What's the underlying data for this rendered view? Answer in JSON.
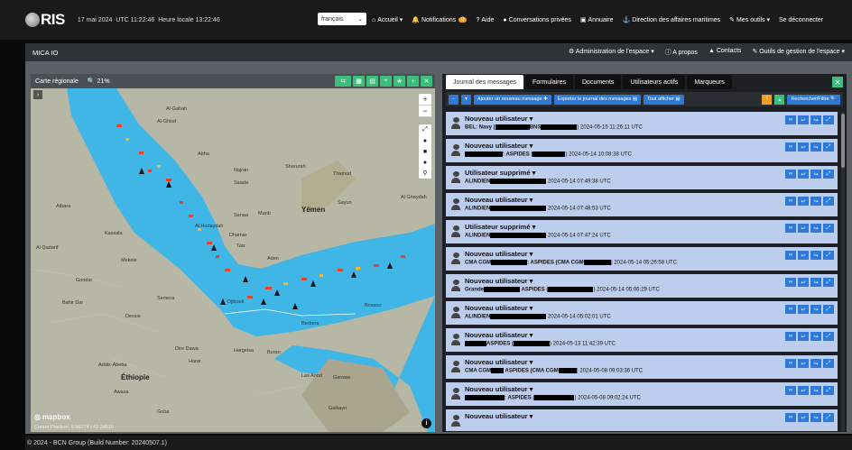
{
  "topbar": {
    "logo": "RIS",
    "date": "17 mai 2024",
    "utc": "UTC  11:22:46",
    "local": "Heure locale 13:22:46",
    "language": "français",
    "nav": [
      {
        "icon": "home-icon",
        "label": "Accueil ▾"
      },
      {
        "icon": "bell-icon",
        "label": "Notifications",
        "badge": "0"
      },
      {
        "icon": "question-icon",
        "label": "Aide"
      },
      {
        "icon": "chat-icon",
        "label": "Conversations privées"
      },
      {
        "icon": "book-icon",
        "label": "Annuaire"
      },
      {
        "icon": "anchor-icon",
        "label": "Direction des affaires maritimes"
      },
      {
        "icon": "wrench-icon",
        "label": "Mes outils ▾"
      },
      {
        "icon": "logout-icon",
        "label": "Se déconnecter"
      }
    ]
  },
  "subbar": {
    "title": "MICA IO",
    "nav": [
      {
        "label": "Administration de l'espace ▾"
      },
      {
        "label": "A propos"
      },
      {
        "label": "Contacts"
      },
      {
        "label": "Outils de gestion de l'espace ▾"
      }
    ]
  },
  "map": {
    "title": "Carte régionale",
    "zoom": "21%",
    "labels": [
      {
        "text": "Al-Gahah"
      },
      {
        "text": "Al-Ghisd"
      },
      {
        "text": "Abha"
      },
      {
        "text": "Najran"
      },
      {
        "text": "Sharurah"
      },
      {
        "text": "Thamud"
      },
      {
        "text": "Saada"
      },
      {
        "text": "Al Ghaydah"
      },
      {
        "text": "Yémen"
      },
      {
        "text": "Sayun"
      },
      {
        "text": "Sanaa"
      },
      {
        "text": "Marib"
      },
      {
        "text": "Dhamar"
      },
      {
        "text": "Al Hudaydah"
      },
      {
        "text": "Taiz"
      },
      {
        "text": "Aden"
      },
      {
        "text": "Atbara"
      },
      {
        "text": "Kassala"
      },
      {
        "text": "Al Qadarif"
      },
      {
        "text": "Mekele"
      },
      {
        "text": "Gondar"
      },
      {
        "text": "Bahir Dar"
      },
      {
        "text": "Dessie"
      },
      {
        "text": "Semera"
      },
      {
        "text": "Djibouti"
      },
      {
        "text": "Bosaso"
      },
      {
        "text": "Berbera"
      },
      {
        "text": "Hargeisa"
      },
      {
        "text": "Burao"
      },
      {
        "text": "Dire Dawa"
      },
      {
        "text": "Addis-Abeba"
      },
      {
        "text": "Éthiopie"
      },
      {
        "text": "Awasa"
      },
      {
        "text": "Las Anod"
      },
      {
        "text": "Garowe"
      },
      {
        "text": "Galkayo"
      },
      {
        "text": "Harar"
      },
      {
        "text": "Goba"
      }
    ],
    "mapbox": "mapbox",
    "cursor": "Cursor Position: 8.56774 / 42.24515"
  },
  "messages": {
    "tabs": [
      "Journal des messages",
      "Formulaires",
      "Documents",
      "Utilisateurs actifs",
      "Marqueurs"
    ],
    "toolbar": {
      "new_message": "Ajouter un nouveau message ✚",
      "export": "Exporter le journal des messages ▤",
      "show_all": "Tout afficher ▤",
      "search": "Rechercher/Filtre 🔍"
    },
    "rows": [
      {
        "title": "Nouveau utilisateur ▾",
        "pre": "BEL: Navy (",
        "mid": "BNS",
        "post": ") 2024-05-15 11:26:11 UTC",
        "r1": 38,
        "r2": 40
      },
      {
        "title": "Nouveau utilisateur ▾",
        "pre": "",
        "mid": ": ASPIDES (",
        "post": ") 2024-05-14 10:08:38 UTC",
        "r1": 42,
        "r2": 36
      },
      {
        "title": "Utilisateur supprimé ▾",
        "pre": "ALINDIEN",
        "mid": "",
        "post": " 2024-05-14 07:49:38 UTC",
        "r1": 62,
        "r2": 0
      },
      {
        "title": "Nouveau utilisateur ▾",
        "pre": "ALINDIEN",
        "mid": "",
        "post": " 2024-05-14 07:48:53 UTC",
        "r1": 62,
        "r2": 0
      },
      {
        "title": "Utilisateur supprimé ▾",
        "pre": "ALINDIEN",
        "mid": "",
        "post": " 2024-05-14 07:47:24 UTC",
        "r1": 62,
        "r2": 0
      },
      {
        "title": "Nouveau utilisateur ▾",
        "pre": "CMA CGM",
        "mid": ": ASPIDES (CMA CGM",
        "post": ") 2024-05-14 05:26:58 UTC",
        "r1": 40,
        "r2": 30
      },
      {
        "title": "Nouveau utilisateur ▾",
        "pre": "Grande",
        "mid": " ASPIDES (",
        "post": ") 2024-05-14 05:06:29 UTC",
        "r1": 40,
        "r2": 50
      },
      {
        "title": "Nouveau utilisateur ▾",
        "pre": "ALINDIEN",
        "mid": "",
        "post": " 2024-05-14 05:02:01 UTC",
        "r1": 62,
        "r2": 0
      },
      {
        "title": "Nouveau utilisateur ▾",
        "pre": "",
        "mid": "ASPIDES (",
        "post": ") 2024-05-13 11:42:39 UTC",
        "r1": 24,
        "r2": 40
      },
      {
        "title": "Nouveau utilisateur ▾",
        "pre": "CMA CGM",
        "mid": " ASPIDES (CMA CGM",
        "post": ") 2024-05-08 09:03:36 UTC",
        "r1": 14,
        "r2": 20
      },
      {
        "title": "Nouveau utilisateur ▾",
        "pre": "",
        "mid": ": ASPIDES (",
        "post": ") 2024-05-08 09:02:24 UTC",
        "r1": 44,
        "r2": 44
      },
      {
        "title": "Nouveau utilisateur ▾",
        "pre": "",
        "mid": "",
        "post": "",
        "r1": 0,
        "r2": 0
      }
    ]
  },
  "footer": "© 2024 - BCN Group (Build Number: 20240507.1)",
  "colors": {
    "accent_blue": "#2f7ad8",
    "accent_green": "#3bbf7a",
    "accent_orange": "#f0a020",
    "row_bg": "#bccdee",
    "sea": "#3fb6e6"
  }
}
